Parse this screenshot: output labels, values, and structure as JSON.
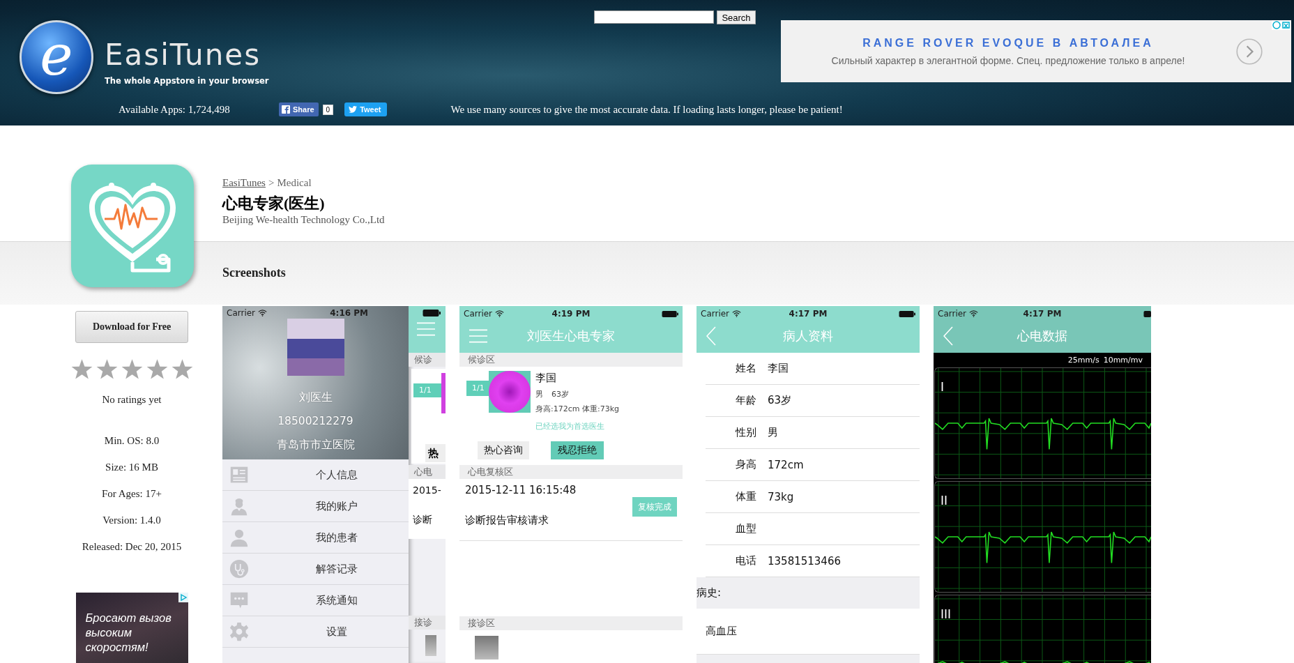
{
  "header": {
    "search": {
      "button": "Search"
    },
    "logo": {
      "mark": "e",
      "title": "EasiTunes",
      "tagline": "The whole Appstore in your browser"
    },
    "ad": {
      "headline": "RANGE ROVER EVOQUE В АВТОАЛЕА",
      "text": "Сильный характер в элегантной форме. Спец. предложение только в апреле!"
    },
    "available_apps": "Available Apps: 1,724,498",
    "share": {
      "label": "Share",
      "count": "0"
    },
    "tweet": "Tweet",
    "notice": "We use many sources to give the most accurate data. If loading lasts longer, please be patient!"
  },
  "app": {
    "breadcrumb": {
      "link": "EasiTunes",
      "separator": ">",
      "current": "Medical"
    },
    "title": "心电专家(医生)",
    "developer": "Beijing We-health Technology Co.,Ltd"
  },
  "sidebar": {
    "download": "Download for Free",
    "stars": 0,
    "rating_text": "No ratings yet",
    "facts": [
      "Min. OS: 8.0",
      "Size: 16 MB",
      "For Ages: 17+",
      "Version: 1.4.0",
      "Released: Dec 20, 2015"
    ],
    "ad": {
      "text": "Бросают вызов высоким скоростям!"
    }
  },
  "screenshots": {
    "heading": "Screenshots",
    "phones": [
      {
        "kind": "drawer",
        "status": {
          "carrier": "Carrier",
          "time": "4:16 PM"
        },
        "doctor": {
          "name": "刘医生",
          "phone": "18500212279",
          "hospital": "青岛市市立医院"
        },
        "menu": [
          "个人信息",
          "我的账户",
          "我的患者",
          "解答记录",
          "系统通知",
          "设置"
        ],
        "peek": {
          "section1": "候诊",
          "badge": "1/1",
          "button": "热",
          "section2": "心电",
          "date": "2015-",
          "request": "诊断",
          "section3": "接诊"
        }
      },
      {
        "kind": "waiting",
        "status": {
          "carrier": "Carrier",
          "time": "4:19 PM"
        },
        "title": "刘医生心电专家",
        "section1": "候诊区",
        "patient": {
          "badge": "1/1",
          "name": "李国",
          "sex": "男",
          "age": "63岁",
          "body": "身高:172cm 体重:73kg",
          "note": "已经选我为首选医生",
          "accept": "热心咨询",
          "reject": "残忍拒绝"
        },
        "section2": "心电复核区",
        "review": {
          "date": "2015-12-11 16:15:48",
          "button": "复核完成",
          "request": "诊断报告审核请求"
        },
        "section3": "接诊区"
      },
      {
        "kind": "profile",
        "status": {
          "carrier": "Carrier",
          "time": "4:17 PM"
        },
        "title": "病人资料",
        "rows": [
          {
            "label": "姓名",
            "value": "李国"
          },
          {
            "label": "年龄",
            "value": "63岁"
          },
          {
            "label": "性别",
            "value": "男"
          },
          {
            "label": "身高",
            "value": "172cm"
          },
          {
            "label": "体重",
            "value": "73kg"
          },
          {
            "label": "血型"
          },
          {
            "label": "电话",
            "value": "13581513466"
          }
        ],
        "history_label": "病史:",
        "history": "高血压"
      },
      {
        "kind": "ecg",
        "status": {
          "carrier": "Carrier",
          "time": "4:17 PM"
        },
        "title": "心电数据",
        "speed": "25mm/s",
        "gain": "10mm/mv",
        "leads": [
          "I",
          "II",
          "III"
        ]
      }
    ]
  }
}
